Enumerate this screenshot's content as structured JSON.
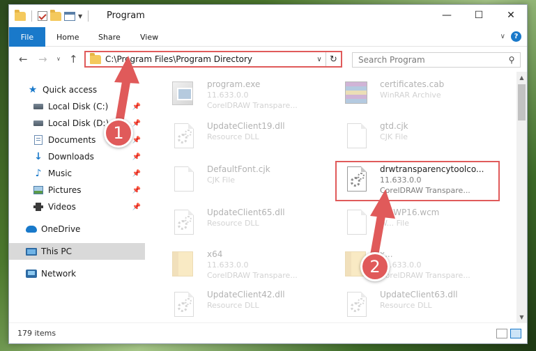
{
  "window": {
    "title": "Program",
    "minimize": "—",
    "maximize": "☐",
    "close": "✕"
  },
  "ribbon": {
    "tabs": [
      "File",
      "Home",
      "Share",
      "View"
    ],
    "help": "?"
  },
  "address": {
    "path": "C:\\Program Files\\Program Directory",
    "refresh": "↻"
  },
  "search": {
    "placeholder": "Search Program"
  },
  "sidebar": {
    "items": [
      {
        "label": "Quick access",
        "icon": "star-icon"
      },
      {
        "label": "Local Disk (C:)",
        "icon": "disk-icon",
        "pinned": true
      },
      {
        "label": "Local Disk (D:)",
        "icon": "disk-icon",
        "pinned": true
      },
      {
        "label": "Documents",
        "icon": "documents-icon",
        "pinned": true
      },
      {
        "label": "Downloads",
        "icon": "download-icon",
        "pinned": true
      },
      {
        "label": "Music",
        "icon": "music-icon",
        "pinned": true
      },
      {
        "label": "Pictures",
        "icon": "pictures-icon",
        "pinned": true
      },
      {
        "label": "Videos",
        "icon": "videos-icon",
        "pinned": true
      },
      {
        "label": "OneDrive",
        "icon": "cloud-icon"
      },
      {
        "label": "This PC",
        "icon": "pc-icon",
        "selected": true
      },
      {
        "label": "Network",
        "icon": "network-icon"
      }
    ]
  },
  "files": [
    {
      "name": "program.exe",
      "line1": "11.633.0.0",
      "line2": "CorelDRAW Transpare...",
      "icon": "exe-icon"
    },
    {
      "name": "certificates.cab",
      "line1": "WinRAR Archive",
      "line2": "",
      "icon": "rar-icon"
    },
    {
      "name": "UpdateClient19.dll",
      "line1": "Resource DLL",
      "line2": "",
      "icon": "dll-icon"
    },
    {
      "name": "gtd.cjk",
      "line1": "CJK File",
      "line2": "",
      "icon": "file-icon"
    },
    {
      "name": "DefaultFont.cjk",
      "line1": "CJK File",
      "line2": "",
      "icon": "file-icon"
    },
    {
      "name": "drwtransparencytoolco...",
      "line1": "11.633.0.0",
      "line2": "CorelDRAW Transpare...",
      "icon": "dll-icon"
    },
    {
      "name": "UpdateClient65.dll",
      "line1": "Resource DLL",
      "line2": "",
      "icon": "dll-icon"
    },
    {
      "name": "5...WP16.wcm",
      "line1": "W... File",
      "line2": "",
      "icon": "file-icon"
    },
    {
      "name": "x64",
      "line1": "11.633.0.0",
      "line2": "CorelDRAW Transpare...",
      "icon": "folder-icon"
    },
    {
      "name": "x...",
      "line1": "11.633.0.0",
      "line2": "CorelDRAW Transpare...",
      "icon": "folder-icon"
    },
    {
      "name": "UpdateClient42.dll",
      "line1": "Resource DLL",
      "line2": "",
      "icon": "dll-icon"
    },
    {
      "name": "UpdateClient63.dll",
      "line1": "Resource DLL",
      "line2": "",
      "icon": "dll-icon"
    }
  ],
  "status": {
    "count": "179 items"
  },
  "annotations": {
    "step1": "1",
    "step2": "2",
    "color": "#e05a5a"
  }
}
